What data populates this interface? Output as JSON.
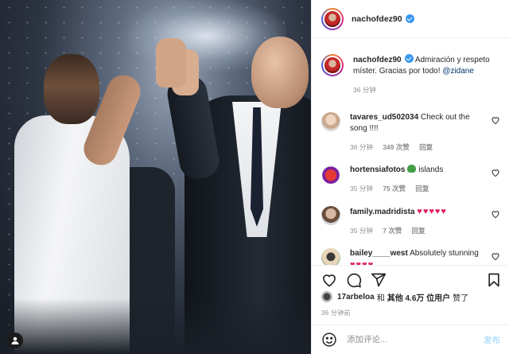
{
  "post": {
    "username": "nachofdez90",
    "caption_text": "Admiración y respeto míster. Gracias por todo!",
    "caption_mention": "@zidane",
    "caption_time": "36 分钟"
  },
  "comments": [
    {
      "username": "tavares_ud502034",
      "text": "Check out the song !!!!",
      "time": "36 分钟",
      "likes": "349 次赞",
      "reply": "回复"
    },
    {
      "username": "hortensiafotos",
      "emoji": "frog",
      "text": "islands",
      "time": "35 分钟",
      "likes": "75 次赞",
      "reply": "回复"
    },
    {
      "username": "family.madridista",
      "hearts": "♥♥♥♥♥",
      "time": "35 分钟",
      "likes": "7 次赞",
      "reply": "回复"
    },
    {
      "username": "bailey____west",
      "text": "Absolutely stunning",
      "hearts": "♥♥♥♥",
      "time": "",
      "likes": "",
      "reply": ""
    }
  ],
  "likes": {
    "first_user": "17arbeloa",
    "and": "和",
    "others": "其他 4.6万 位用户",
    "suffix": "赞了"
  },
  "timestamp": "36 分钟前",
  "add_comment": {
    "placeholder": "添加评论...",
    "post_label": "发布"
  },
  "icons": {
    "actions": [
      "heart-icon",
      "comment-icon",
      "share-icon",
      "bookmark-icon"
    ],
    "comment_like": "heart-icon",
    "emoji": "smiley-icon",
    "photo_badge": "user-tag-icon"
  },
  "colors": {
    "verified": "#3897f0",
    "mention": "#00376b",
    "post_button": "#b2dffc",
    "hearts": "#e0245e"
  }
}
